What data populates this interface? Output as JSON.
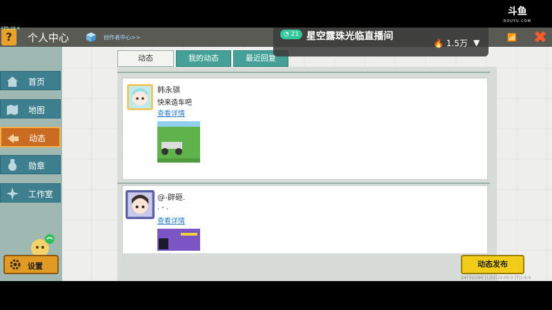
{
  "overlay": {
    "fps": "FPS:29.4",
    "watermark_cn": "斗鱼",
    "watermark_en": "DOUYU.COM",
    "live_badge": "21",
    "stream_title": "星空露珠光临直播间",
    "heat": "1.5万",
    "status_line": "2473|2290  [1/22]22:00:0  [7|1:6:0"
  },
  "header": {
    "help_label": "?",
    "title": "个人中心",
    "creator_link": "创作者中心>>",
    "close_label": "✖"
  },
  "sidebar": {
    "items": [
      {
        "label": "首页",
        "icon": "home-icon"
      },
      {
        "label": "地图",
        "icon": "map-icon"
      },
      {
        "label": "动态",
        "icon": "feed-icon",
        "active": true
      },
      {
        "label": "勋章",
        "icon": "medal-icon"
      },
      {
        "label": "工作室",
        "icon": "studio-icon"
      }
    ],
    "settings_label": "设置"
  },
  "tabs": [
    {
      "label": "动态",
      "active": true
    },
    {
      "label": "我的动态",
      "active": false
    },
    {
      "label": "最近回复",
      "active": false
    }
  ],
  "posts": [
    {
      "username": "韩永骐",
      "text": "快来造车吧",
      "link": "查看详情"
    },
    {
      "username": "@-辟砸.",
      "text": ". - .",
      "link": "查看详情"
    }
  ],
  "publish_button": "动态发布",
  "colors": {
    "sidebar_active": "#c96c21",
    "sidebar_item": "#3d7f8f",
    "tab_active": "#f3f3f1",
    "tab_inactive": "#45a197",
    "publish": "#f1cc18",
    "link": "#2a7fc8"
  }
}
